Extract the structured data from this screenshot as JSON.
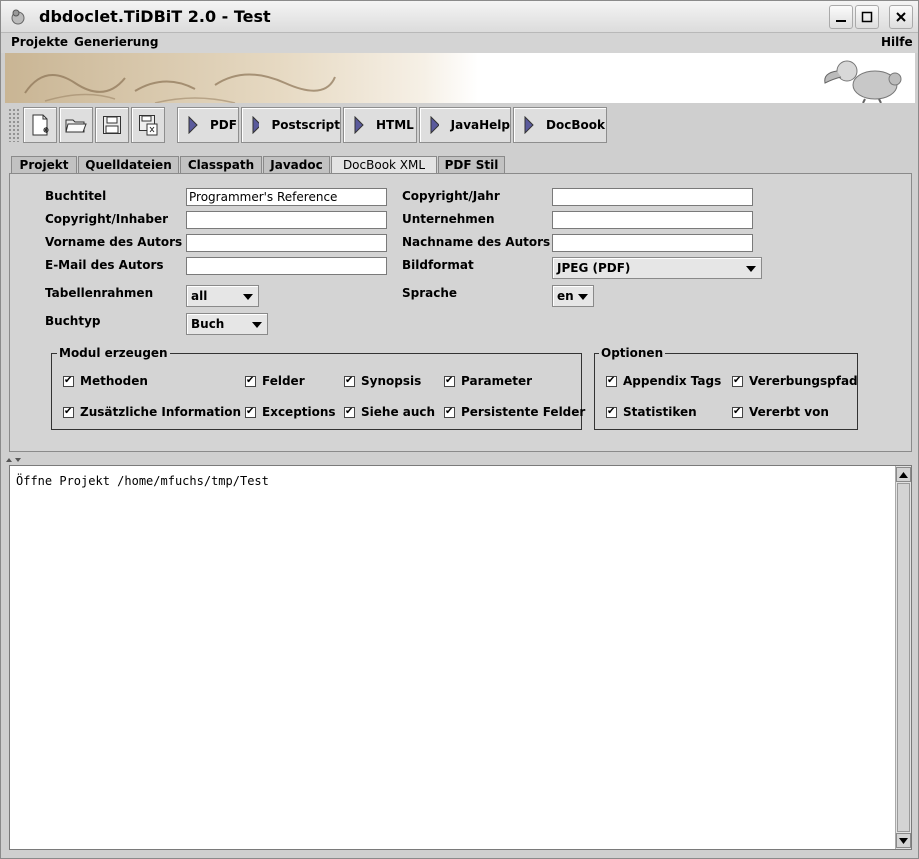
{
  "window": {
    "title": "dbdoclet.TiDBiT 2.0 - Test"
  },
  "menubar": {
    "items": [
      "Projekte",
      "Generierung"
    ],
    "help": "Hilfe"
  },
  "toolbar": {
    "icon_buttons": [
      {
        "name": "new-project-button",
        "icon": "new-document-icon"
      },
      {
        "name": "open-project-button",
        "icon": "open-folder-icon"
      },
      {
        "name": "save-button",
        "icon": "save-icon"
      },
      {
        "name": "save-as-button",
        "icon": "save-as-icon"
      }
    ],
    "run_buttons": [
      "PDF",
      "Postscript",
      "HTML",
      "JavaHelp",
      "DocBook"
    ]
  },
  "tabs": [
    "Projekt",
    "Quelldateien",
    "Classpath",
    "Javadoc",
    "DocBook XML",
    "PDF Stil"
  ],
  "active_tab": "DocBook XML",
  "form": {
    "buchtitel": {
      "label": "Buchtitel",
      "value": "Programmer's Reference"
    },
    "copyright_jahr": {
      "label": "Copyright/Jahr",
      "value": ""
    },
    "copyright_inhaber": {
      "label": "Copyright/Inhaber",
      "value": ""
    },
    "unternehmen": {
      "label": "Unternehmen",
      "value": ""
    },
    "vorname": {
      "label": "Vorname des Autors",
      "value": ""
    },
    "nachname": {
      "label": "Nachname des Autors",
      "value": ""
    },
    "email": {
      "label": "E-Mail des Autors",
      "value": ""
    },
    "bildformat": {
      "label": "Bildformat",
      "value": "JPEG (PDF)"
    },
    "tabellenrahmen": {
      "label": "Tabellenrahmen",
      "value": "all"
    },
    "sprache": {
      "label": "Sprache",
      "value": "en"
    },
    "buchtyp": {
      "label": "Buchtyp",
      "value": "Buch"
    }
  },
  "modul": {
    "legend": "Modul erzeugen",
    "items": [
      "Methoden",
      "Felder",
      "Synopsis",
      "Parameter",
      "Zusätzliche Information",
      "Exceptions",
      "Siehe auch",
      "Persistente Felder"
    ]
  },
  "optionen": {
    "legend": "Optionen",
    "items": [
      "Appendix Tags",
      "Vererbungspfad",
      "Statistiken",
      "Vererbt von"
    ]
  },
  "log": {
    "text": "Öffne Projekt /home/mfuchs/tmp/Test"
  },
  "colors": {
    "toolbar_arrow": "#5a5a9c",
    "panel": "#d4d4d4"
  }
}
